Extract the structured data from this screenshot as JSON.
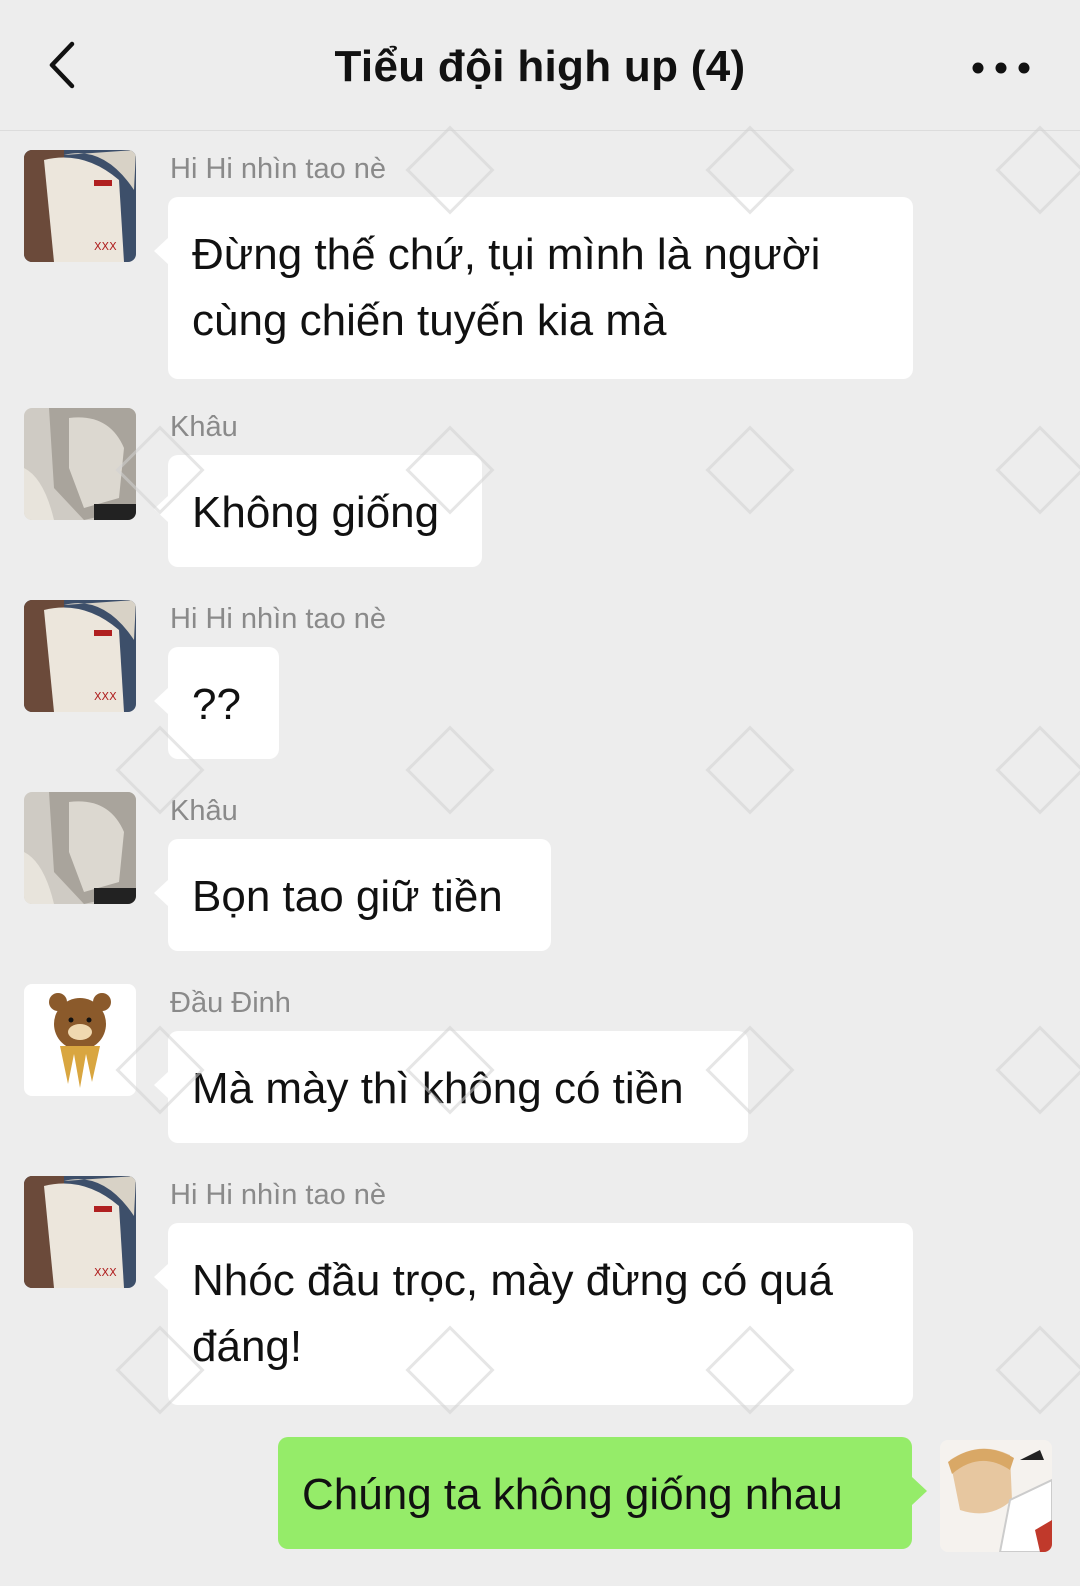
{
  "header": {
    "title": "Tiểu đội high up (4)",
    "back_icon": "chevron-left-icon",
    "more_icon": "more-dots-icon"
  },
  "messages": [
    {
      "sender": "Hi Hi nhìn tao nè",
      "text_lines": [
        "Đừng thế chứ, tụi mình là người",
        "cùng chiến tuyến kia mà"
      ],
      "side": "left"
    },
    {
      "sender": "Khâu",
      "text_lines": [
        "Không giống"
      ],
      "side": "left"
    },
    {
      "sender": "Hi Hi nhìn tao nè",
      "text_lines": [
        "??"
      ],
      "side": "left"
    },
    {
      "sender": "Khâu",
      "text_lines": [
        "Bọn tao giữ tiền"
      ],
      "side": "left"
    },
    {
      "sender": "Đầu Đinh",
      "text_lines": [
        "Mà mày thì không có tiền"
      ],
      "side": "left"
    },
    {
      "sender": "Hi Hi nhìn tao nè",
      "text_lines": [
        "Nhóc đầu trọc, mày đừng có quá",
        "đáng!"
      ],
      "side": "left"
    },
    {
      "text_lines": [
        "Chúng ta không giống nhau"
      ],
      "side": "right"
    }
  ],
  "colors": {
    "background": "#ededed",
    "bubble_other": "#ffffff",
    "bubble_self": "#95ec69",
    "sender_name": "#8a8a8a"
  }
}
